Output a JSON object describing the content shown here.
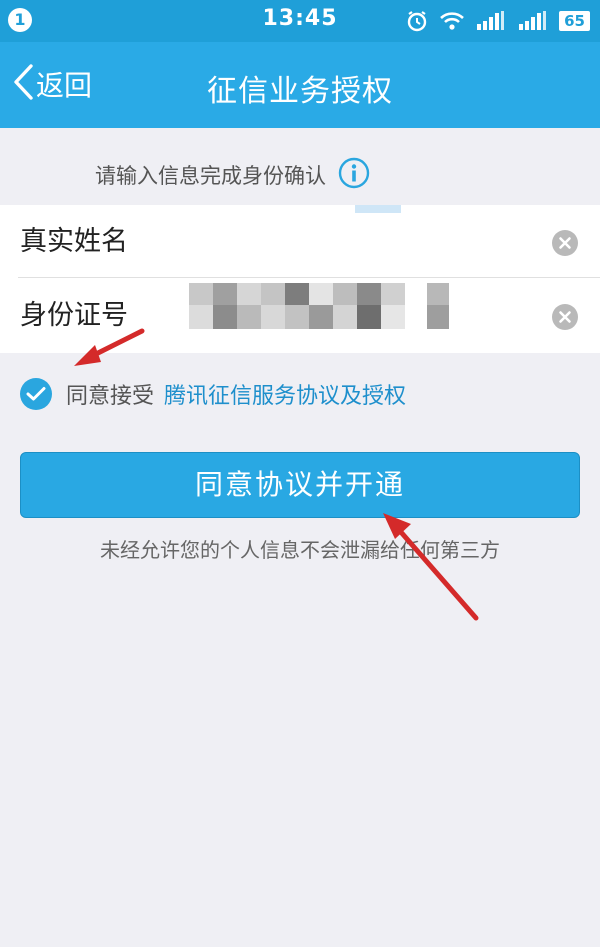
{
  "status_bar": {
    "notification_count": "1",
    "time": "13:45",
    "icons": [
      "alarm-icon",
      "wifi-icon",
      "signal-icon",
      "signal-icon"
    ],
    "battery": "65"
  },
  "nav": {
    "back_label": "返回",
    "title": "征信业务授权"
  },
  "form": {
    "hint": "请输入信息完成身份确认",
    "fields": [
      {
        "label": "真实姓名",
        "value": ""
      },
      {
        "label": "身份证号",
        "value": ""
      }
    ]
  },
  "agreement": {
    "checked": true,
    "prefix": "同意接受",
    "link": "腾讯征信服务协议及授权"
  },
  "actions": {
    "submit_label": "同意协议并开通"
  },
  "footer": {
    "privacy_note": "未经允许您的个人信息不会泄漏给任何第三方"
  },
  "colors": {
    "status_bar": "#1f9fd8",
    "nav_bar": "#2aaae6",
    "accent": "#29a8e3",
    "link": "#1e8fcc",
    "annotation_arrow": "#d42a2a"
  }
}
